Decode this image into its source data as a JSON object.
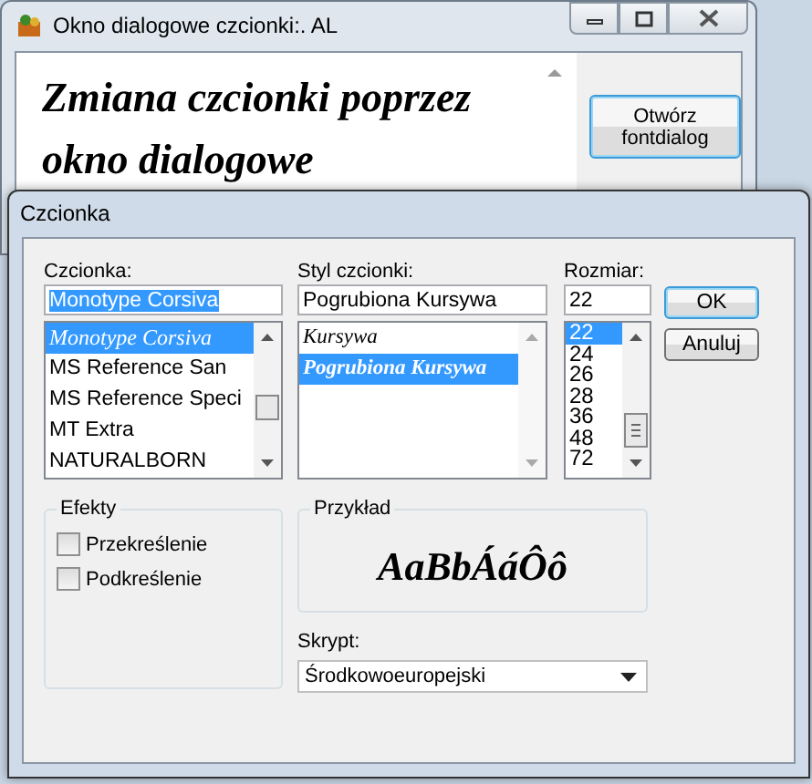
{
  "window": {
    "title": "Okno dialogowe czcionki:. AL",
    "text": "Zmiana czcionki poprzez okno dialogowe",
    "button": "Otwórz fontdialog"
  },
  "dialog": {
    "title": "Czcionka",
    "font": {
      "label": "Czcionka:",
      "value": "Monotype Corsiva",
      "items": [
        {
          "label": "Monotype Corsiva",
          "kind": "script",
          "selected": true
        },
        {
          "label": "MS Reference San",
          "kind": "sans",
          "selected": false
        },
        {
          "label": "MS Reference Speci",
          "kind": "sans",
          "selected": false
        },
        {
          "label": "MT Extra",
          "kind": "sans",
          "selected": false
        },
        {
          "label": "NATURALBORN",
          "kind": "sans",
          "selected": false
        }
      ]
    },
    "style": {
      "label": "Styl czcionki:",
      "value": "Pogrubiona Kursywa",
      "items": [
        {
          "label": "Kursywa",
          "kind": "italic",
          "selected": false
        },
        {
          "label": "Pogrubiona Kursywa",
          "kind": "bold-italic",
          "selected": true
        }
      ]
    },
    "size": {
      "label": "Rozmiar:",
      "value": "22",
      "items": [
        {
          "label": "22",
          "selected": true
        },
        {
          "label": "24",
          "selected": false
        },
        {
          "label": "26",
          "selected": false
        },
        {
          "label": "28",
          "selected": false
        },
        {
          "label": "36",
          "selected": false
        },
        {
          "label": "48",
          "selected": false
        },
        {
          "label": "72",
          "selected": false
        }
      ]
    },
    "buttons": [
      "OK",
      "Anuluj"
    ],
    "effects": {
      "title": "Efekty",
      "options": [
        {
          "label": "Przekreślenie",
          "checked": false
        },
        {
          "label": "Podkreślenie",
          "checked": false
        }
      ]
    },
    "sample": {
      "title": "Przykład",
      "text": "AaBbÁáÔô"
    },
    "script": {
      "label": "Skrypt:",
      "value": "Środkowoeuropejski"
    }
  }
}
